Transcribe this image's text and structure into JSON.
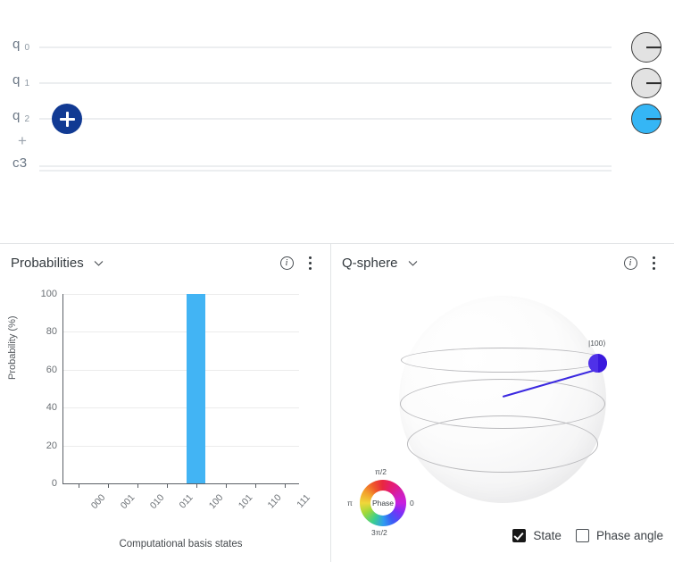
{
  "circuit": {
    "qubits": [
      {
        "name": "q",
        "index": "0",
        "disk_color": "#e2e2e2",
        "phase_deg": 0
      },
      {
        "name": "q",
        "index": "1",
        "disk_color": "#e2e2e2",
        "phase_deg": 0
      },
      {
        "name": "q",
        "index": "2",
        "disk_color": "#35b6f5",
        "phase_deg": 0
      }
    ],
    "classical_register": {
      "label": "c3"
    },
    "add_gate_button": {
      "label": "+"
    },
    "add_qubit_button": {
      "label": "+"
    }
  },
  "probabilities_panel": {
    "title": "Probabilities",
    "dropdown_icon": "chevron-down-icon",
    "info_icon": "info-icon",
    "overflow_icon": "overflow-menu-icon"
  },
  "qsphere_panel": {
    "title": "Q-sphere",
    "dropdown_icon": "chevron-down-icon",
    "info_icon": "info-icon",
    "overflow_icon": "overflow-menu-icon",
    "state_node_label": "|100⟩",
    "phase_wheel": {
      "center_label": "Phase",
      "top": "π/2",
      "left": "π",
      "right": "0",
      "bottom": "3π/2"
    },
    "legend": {
      "state": {
        "label": "State",
        "checked": true
      },
      "phase_angle": {
        "label": "Phase angle",
        "checked": false
      }
    }
  },
  "chart_data": {
    "type": "bar",
    "title": "Probabilities",
    "categories": [
      "000",
      "001",
      "010",
      "011",
      "100",
      "101",
      "110",
      "111"
    ],
    "values": [
      0,
      0,
      0,
      0,
      100,
      0,
      0,
      0
    ],
    "xlabel": "Computational basis states",
    "ylabel": "Probability (%)",
    "ylim": [
      0,
      100
    ],
    "yticks": [
      0,
      20,
      40,
      60,
      80,
      100
    ],
    "bar_color": "#42b4f4",
    "grid": true,
    "legend": "none"
  }
}
